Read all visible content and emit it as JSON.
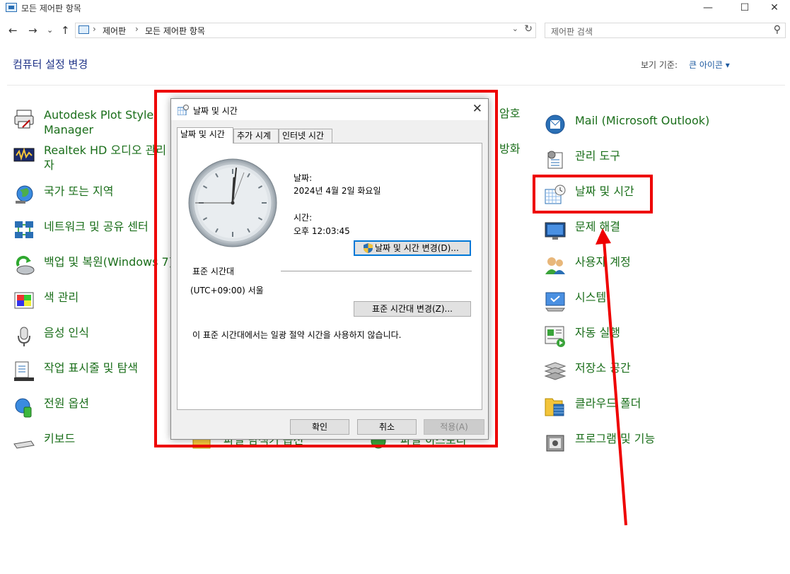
{
  "window": {
    "title": "모든 제어판 항목",
    "minimize": "—",
    "maximize": "☐",
    "close": "✕"
  },
  "nav": {
    "back": "←",
    "forward": "→",
    "recent": "⌄",
    "up": "↑",
    "breadcrumb": [
      "제어판",
      "모든 제어판 항목"
    ],
    "crumb_sep": "›",
    "dropdown": "⌄",
    "refresh": "↻",
    "search_placeholder": "제어판 검색",
    "search_icon": "⚲"
  },
  "header": {
    "title": "컴퓨터 설정 변경",
    "view_by_label": "보기 기준:",
    "view_by_value": "큰 아이콘 ▾"
  },
  "items": {
    "col1": [
      {
        "label": "Autodesk Plot Style",
        "label2": "Manager",
        "icon": "printer-icon"
      },
      {
        "label": "Realtek HD 오디오 관리",
        "label2": "자",
        "icon": "audio-manager-icon"
      },
      {
        "label": "국가 또는 지역",
        "icon": "globe-icon"
      },
      {
        "label": "네트워크 및 공유 센터",
        "icon": "network-icon"
      },
      {
        "label": "백업 및 복원(Windows 7)",
        "icon": "backup-icon"
      },
      {
        "label": "색 관리",
        "icon": "color-management-icon"
      },
      {
        "label": "음성 인식",
        "icon": "microphone-icon"
      },
      {
        "label": "작업 표시줄 및 탐색",
        "icon": "taskbar-icon"
      },
      {
        "label": "전원 옵션",
        "icon": "power-icon"
      },
      {
        "label": "키보드",
        "icon": "keyboard-icon"
      }
    ],
    "col3_partial": [
      {
        "label": "암호",
        "icon": "credential-icon"
      },
      {
        "label": "방화",
        "icon": "firewall-icon"
      }
    ],
    "bottom_partial": [
      {
        "label": "파일 탐색기 옵션",
        "icon": "folder-options-icon"
      },
      {
        "label": "파일 히스토리",
        "icon": "file-history-icon"
      }
    ],
    "col4": [
      {
        "label": "Mail (Microsoft Outlook)",
        "icon": "mail-icon"
      },
      {
        "label": "관리 도구",
        "icon": "admin-tools-icon"
      },
      {
        "label": "날짜 및 시간",
        "icon": "date-time-icon"
      },
      {
        "label": "문제 해결",
        "icon": "troubleshooting-icon"
      },
      {
        "label": "사용자 계정",
        "icon": "user-accounts-icon"
      },
      {
        "label": "시스템",
        "icon": "system-icon"
      },
      {
        "label": "자동 실행",
        "icon": "autoplay-icon"
      },
      {
        "label": "저장소 공간",
        "icon": "storage-spaces-icon"
      },
      {
        "label": "클라우드 폴더",
        "icon": "cloud-folder-icon"
      },
      {
        "label": "프로그램 및 기능",
        "icon": "programs-icon"
      }
    ]
  },
  "dialog": {
    "title": "날짜 및 시간",
    "close": "✕",
    "tabs": [
      "날짜 및 시간",
      "추가 시계",
      "인터넷 시간"
    ],
    "date_label": "날짜:",
    "date_value": "2024년 4월 2일 화요일",
    "time_label": "시간:",
    "time_value": "오후 12:03:45",
    "change_datetime_button": "날짜 및 시간 변경(D)...",
    "timezone_heading": "표준 시간대",
    "timezone_value": "(UTC+09:00) 서울",
    "change_timezone_button": "표준 시간대 변경(Z)...",
    "dst_note": "이 표준 시간대에서는 일광 절약 시간을 사용하지 않습니다.",
    "ok_button": "확인",
    "cancel_button": "취소",
    "apply_button": "적용(A)"
  },
  "colors": {
    "highlight": "#ee0000",
    "link_green": "#1a6e1a",
    "heading_blue": "#1e3287"
  }
}
